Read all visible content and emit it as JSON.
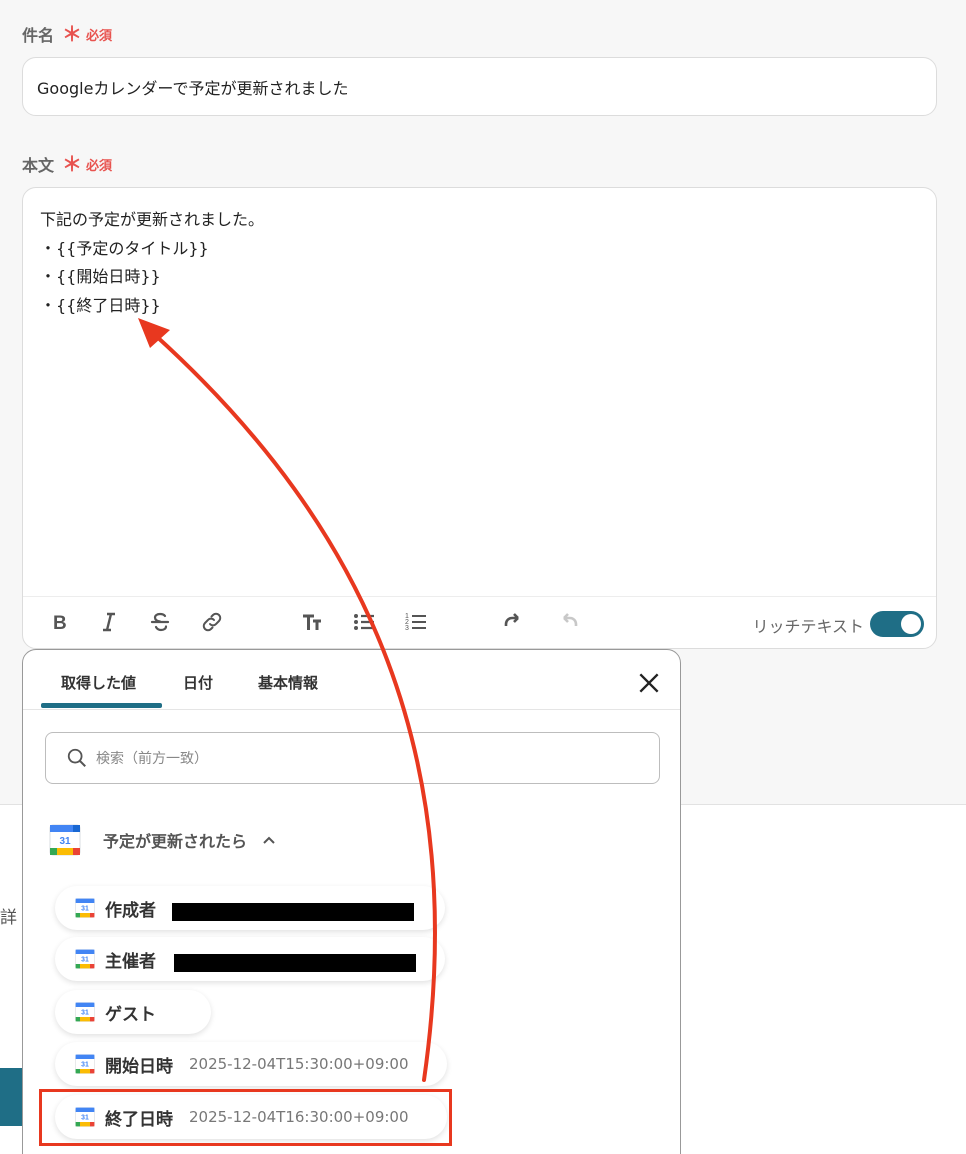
{
  "subject": {
    "label": "件名",
    "required_mark": "＊",
    "required_text": "必須",
    "value": "Googleカレンダーで予定が更新されました"
  },
  "body": {
    "label": "本文",
    "required_mark": "＊",
    "required_text": "必須",
    "lines": [
      "下記の予定が更新されました。",
      "・{{予定のタイトル}}",
      "・{{開始日時}}",
      "・{{終了日時}}"
    ]
  },
  "toolbar": {
    "rich_text_label": "リッチテキスト",
    "rich_text_enabled": true
  },
  "panel": {
    "tabs": [
      "取得した値",
      "日付",
      "基本情報"
    ],
    "active_tab": 0,
    "search_placeholder": "検索（前方一致）",
    "section_title": "予定が更新されたら",
    "calendar_icon_text": "31",
    "items": [
      {
        "label": "作成者",
        "value": ""
      },
      {
        "label": "主催者",
        "value": ""
      },
      {
        "label": "ゲスト",
        "value": ""
      },
      {
        "label": "開始日時",
        "value": "2025-12-04T15:30:00+09:00"
      },
      {
        "label": "終了日時",
        "value": "2025-12-04T16:30:00+09:00"
      }
    ]
  },
  "side": {
    "detail_char": "詳"
  },
  "colors": {
    "accent": "#1f6e86",
    "required": "#e8534f",
    "annotation": "#e8381f"
  }
}
